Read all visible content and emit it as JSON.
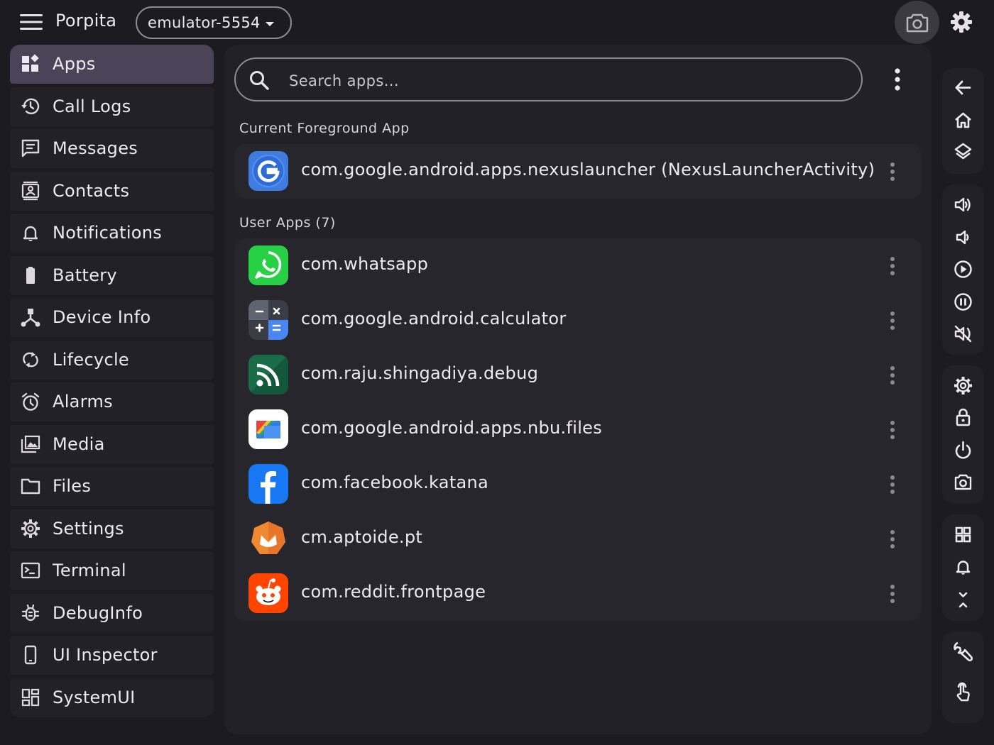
{
  "header": {
    "title": "Porpita",
    "device": "emulator-5554",
    "icons": [
      "menu-icon",
      "chevron-down-icon",
      "camera-icon",
      "settings-gear-icon"
    ]
  },
  "sidebar": {
    "items": [
      {
        "label": "Apps",
        "icon": "apps-icon",
        "active": true
      },
      {
        "label": "Call Logs",
        "icon": "history-icon"
      },
      {
        "label": "Messages",
        "icon": "message-icon"
      },
      {
        "label": "Contacts",
        "icon": "contact-card-icon"
      },
      {
        "label": "Notifications",
        "icon": "bell-icon"
      },
      {
        "label": "Battery",
        "icon": "battery-icon"
      },
      {
        "label": "Device Info",
        "icon": "device-hub-icon"
      },
      {
        "label": "Lifecycle",
        "icon": "sync-icon"
      },
      {
        "label": "Alarms",
        "icon": "alarm-clock-icon"
      },
      {
        "label": "Media",
        "icon": "photo-library-icon"
      },
      {
        "label": "Files",
        "icon": "folder-icon"
      },
      {
        "label": "Settings",
        "icon": "gear-icon"
      },
      {
        "label": "Terminal",
        "icon": "terminal-icon"
      },
      {
        "label": "DebugInfo",
        "icon": "bug-icon"
      },
      {
        "label": "UI Inspector",
        "icon": "phone-icon"
      },
      {
        "label": "SystemUI",
        "icon": "dashboard-icon"
      }
    ]
  },
  "search": {
    "placeholder": "Search apps..."
  },
  "foreground": {
    "title": "Current Foreground App",
    "app": {
      "package": "com.google.android.apps.nexuslauncher (NexusLauncherActivity)",
      "icon": "google-icon"
    }
  },
  "user_apps": {
    "title": "User Apps (7)",
    "apps": [
      {
        "package": "com.whatsapp",
        "icon": "whatsapp-icon"
      },
      {
        "package": "com.google.android.calculator",
        "icon": "calculator-icon"
      },
      {
        "package": "com.raju.shingadiya.debug",
        "icon": "rss-icon"
      },
      {
        "package": "com.google.android.apps.nbu.files",
        "icon": "files-icon"
      },
      {
        "package": "com.facebook.katana",
        "icon": "facebook-icon"
      },
      {
        "package": "cm.aptoide.pt",
        "icon": "aptoide-icon"
      },
      {
        "package": "com.reddit.frontpage",
        "icon": "reddit-icon"
      }
    ]
  },
  "toolbar": {
    "groups": [
      [
        "back-arrow-icon",
        "home-icon",
        "layers-icon"
      ],
      [
        "volume-up-icon",
        "volume-down-icon",
        "play-icon",
        "pause-icon",
        "mute-icon"
      ],
      [
        "settings-icon",
        "lock-icon",
        "power-icon",
        "screenshot-icon"
      ],
      [
        "grid-icon",
        "bell-icon",
        "collapse-icon"
      ],
      [
        "wrench-icon",
        "touch-icon"
      ]
    ]
  },
  "colors": {
    "background": "#1c1b21",
    "panel": "#222127",
    "card": "#28262d",
    "active_nav": "#4b4459",
    "text": "#ece9f1",
    "outline": "#8e8b94"
  }
}
